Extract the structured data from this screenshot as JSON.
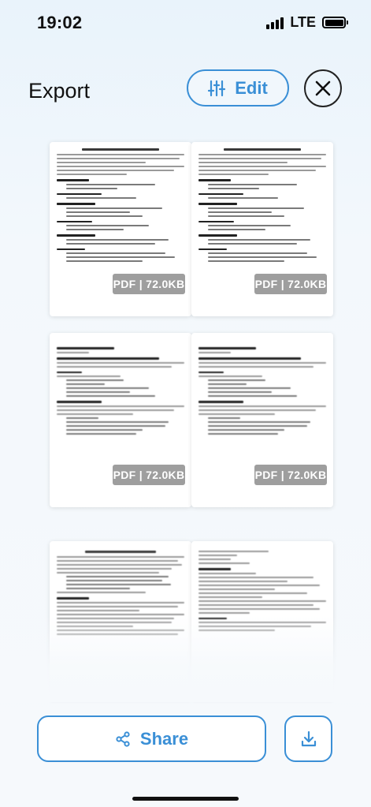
{
  "status_bar": {
    "time": "19:02",
    "network": "LTE"
  },
  "header": {
    "title": "Export",
    "edit_label": "Edit"
  },
  "icons": {
    "edit": "sliders-icon",
    "close": "close-icon",
    "share": "share-icon",
    "download": "download-icon"
  },
  "accent_color": "#3a8fd6",
  "documents": [
    {
      "badge": "PDF | 72.0KB"
    },
    {
      "badge": "PDF | 72.0KB"
    },
    {
      "badge": "PDF | 72.0KB"
    },
    {
      "badge": "PDF | 72.0KB"
    },
    {
      "badge": ""
    },
    {
      "badge": ""
    }
  ],
  "actions": {
    "share_label": "Share"
  }
}
